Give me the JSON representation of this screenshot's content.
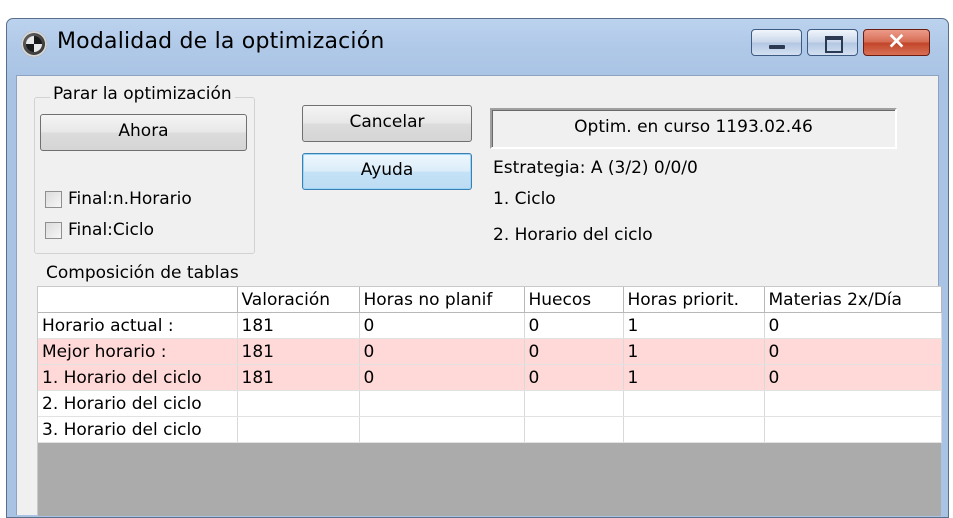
{
  "window": {
    "title": "Modalidad de la optimización",
    "buttons": {
      "minimize": "minimize",
      "maximize": "maximize",
      "close": "×"
    }
  },
  "stop_group": {
    "label": "Parar la optimización",
    "now_button": "Ahora",
    "checkboxes": [
      {
        "label": "Final:n.Horario",
        "checked": false
      },
      {
        "label": "Final:Ciclo",
        "checked": false
      }
    ]
  },
  "actions": {
    "cancel": "Cancelar",
    "help": "Ayuda"
  },
  "status": "Optim. en curso 1193.02.46",
  "strategy": "Estrategia: A (3/2)   0/0/0",
  "steps": [
    "1. Ciclo",
    "2. Horario del ciclo"
  ],
  "tables_label": "Composición de tablas",
  "table": {
    "headers": [
      "",
      "Valoración",
      "Horas no planif",
      "Huecos",
      "Horas priorit.",
      "Materias 2x/Día"
    ],
    "rows": [
      {
        "cells": [
          "Horario actual :",
          "181",
          "0",
          "0",
          "1",
          "0"
        ],
        "highlight": false
      },
      {
        "cells": [
          "Mejor horario :",
          "181",
          "0",
          "0",
          "1",
          "0"
        ],
        "highlight": true
      },
      {
        "cells": [
          "1. Horario del ciclo",
          "181",
          "0",
          "0",
          "1",
          "0"
        ],
        "highlight": true
      },
      {
        "cells": [
          "2. Horario del ciclo",
          "",
          "",
          "",
          "",
          ""
        ],
        "highlight": false
      },
      {
        "cells": [
          "3. Horario del ciclo",
          "",
          "",
          "",
          "",
          ""
        ],
        "highlight": false
      }
    ]
  },
  "colors": {
    "highlight_row": "#ffd8d8",
    "title_bar": "#b0c9e8",
    "empty_grid": "#ababab"
  }
}
